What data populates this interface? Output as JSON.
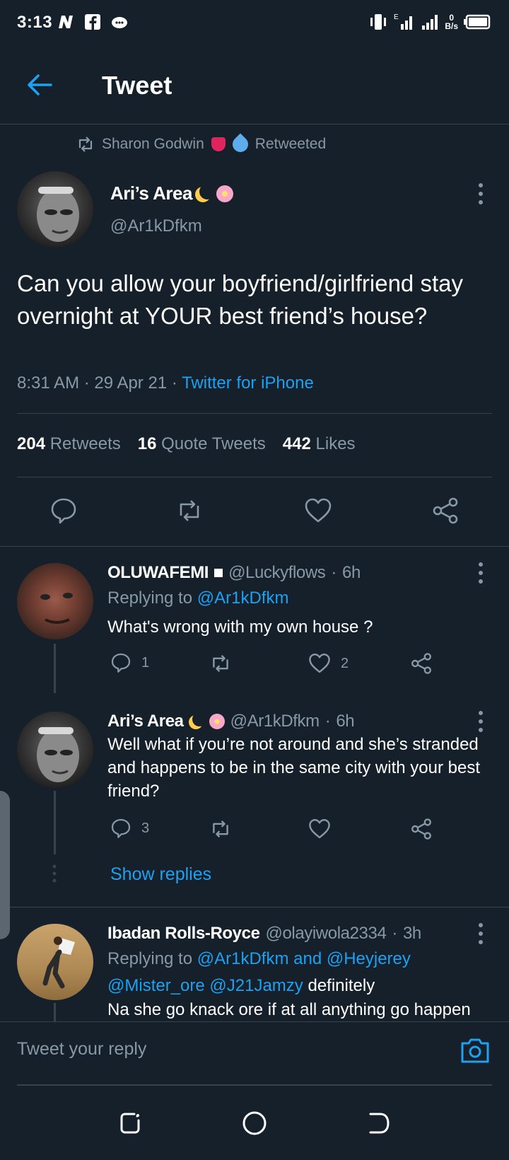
{
  "status_bar": {
    "time": "3:13",
    "net_speed": "0",
    "net_unit": "B/s",
    "net_type": "E"
  },
  "app_bar": {
    "title": "Tweet"
  },
  "retweet": {
    "by": "Sharon Godwin",
    "label": "Retweeted"
  },
  "tweet": {
    "author_name": "Ari’s Area",
    "author_handle": "@Ar1kDfkm",
    "text": "Can you allow your boyfriend/girlfriend stay overnight at YOUR best friend’s house?",
    "time": "8:31 AM",
    "date": "29 Apr 21",
    "source": "Twitter for iPhone",
    "retweets_count": "204",
    "retweets_label": "Retweets",
    "quotes_count": "16",
    "quotes_label": "Quote Tweets",
    "likes_count": "442",
    "likes_label": "Likes"
  },
  "replies": [
    {
      "name": "OLUWAFEMI",
      "handle": "@Luckyflows",
      "age": "6h",
      "replying_label": "Replying to",
      "replying_to": "@Ar1kDfkm",
      "text": "What's wrong with my own house ?",
      "reply_count": "1",
      "like_count": "2"
    },
    {
      "name": "Ari’s Area",
      "handle": "@Ar1kDfkm",
      "age": "6h",
      "text": "Well what if you’re not around and she’s stranded and happens to be in the same city with your best friend?",
      "reply_count": "3"
    },
    {
      "name": "Ibadan Rolls-Royce",
      "handle": "@olayiwola2334",
      "age": "3h",
      "replying_label": "Replying to",
      "replying_to": "@Ar1kDfkm and @Heyjerey",
      "mentions": "@Mister_ore @J21Jamzy",
      "text_after_mentions": "definitely",
      "text_line2": "Na she go knack ore if at all anything go happen"
    }
  ],
  "show_replies": "Show replies",
  "composer": {
    "placeholder": "Tweet your reply"
  },
  "colors": {
    "background": "#15202b",
    "accent": "#1da1f2",
    "secondary_text": "#8899a6",
    "divider": "#38444d"
  },
  "icons": [
    "back-arrow-icon",
    "retweet-icon",
    "more-vertical-icon",
    "reply-icon",
    "like-icon",
    "share-icon",
    "camera-icon",
    "recent-apps-icon",
    "home-icon",
    "back-nav-icon"
  ]
}
